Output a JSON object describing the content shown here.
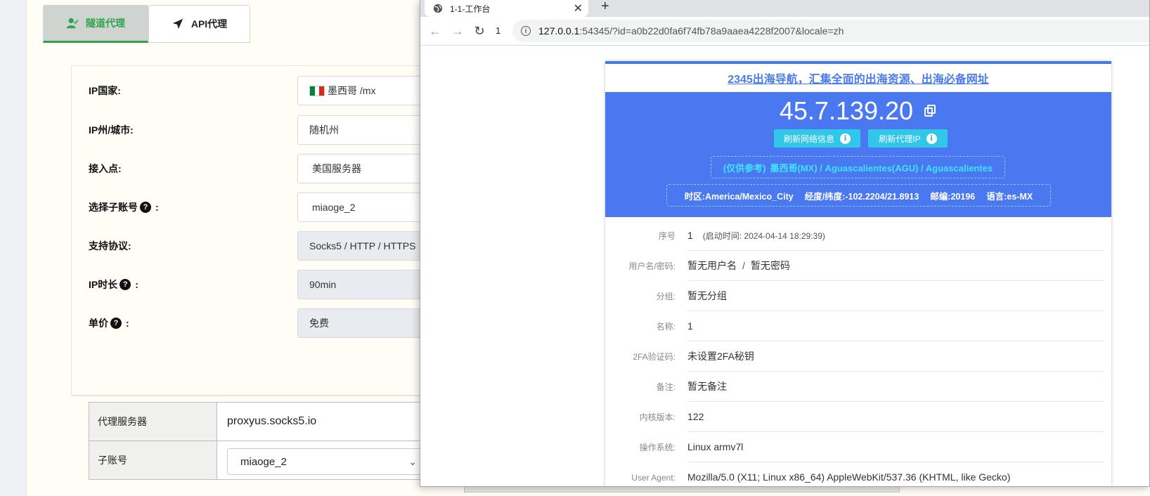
{
  "tabs": {
    "tunnel_label": "隧道代理",
    "api_label": "API代理"
  },
  "form": {
    "rows": [
      {
        "label": "IP国家:",
        "value": "墨西哥 /mx",
        "help": false
      },
      {
        "label": "IP州/城市:",
        "value": "随机州",
        "help": false
      },
      {
        "label": "接入点:",
        "value": "美国服务器",
        "help": false
      },
      {
        "label": "选择子账号",
        "suffix": ":",
        "value": "miaoge_2",
        "help": true
      },
      {
        "label": "支持协议:",
        "value": "Socks5 / HTTP / HTTPS",
        "help": false
      },
      {
        "label": "IP时长",
        "suffix": ":",
        "value": "90min",
        "help": true
      },
      {
        "label": "单价",
        "suffix": ":",
        "value": "免费",
        "help": true
      }
    ]
  },
  "result": {
    "server_label": "代理服务器",
    "server_value": "proxyus.socks5.io",
    "account_label": "子账号",
    "account_value": "miaoge_2"
  },
  "browser": {
    "tab_title": "1-1-工作台",
    "tab_count": "1",
    "url_host": "127.0.0.1",
    "url_rest": ":54345/?id=a0b22d0fa6f74fb78a9aaea4228f2007&locale=zh"
  },
  "card": {
    "nav_link": "2345出海导航，汇集全面的出海资源、出海必备网址",
    "ip": "45.7.139.20",
    "refresh_net_label": "刷新网络信息",
    "refresh_proxy_label": "刷新代理IP",
    "geo_ref": "(仅供参考)",
    "geo_value": "墨西哥(MX) / Aguascalientes(AGU) / Aguascalientes",
    "timezone": "时区:America/Mexico_City",
    "coords": "经度/纬度:-102.2204/21.8913",
    "postal": "邮编:20196",
    "language": "语言:es-MX"
  },
  "info": {
    "seq_label": "序号",
    "seq_value": "1",
    "seq_start": "(启动时间: 2024-04-14 18:29:39)",
    "cred_label": "用户名/密码:",
    "cred_user": "暂无用户名",
    "cred_sep": "/",
    "cred_pass": "暂无密码",
    "group_label": "分组:",
    "group_value": "暂无分组",
    "name_label": "名称:",
    "name_value": "1",
    "twofa_label": "2FA验证码:",
    "twofa_value": "未设置2FA秘钥",
    "note_label": "备注:",
    "note_value": "暂无备注",
    "kernel_label": "内核版本:",
    "kernel_value": "122",
    "os_label": "操作系统:",
    "os_value": "Linux armv7l",
    "ua_label": "User Agent:",
    "ua_value": "Mozilla/5.0 (X11; Linux x86_64) AppleWebKit/537.36 (KHTML, like Gecko)"
  },
  "colors": {
    "accent_green": "#2ea44f",
    "panel_blue": "#4a78f0",
    "button_cyan": "#31c7e8",
    "geo_cyan": "#3fe3ff"
  },
  "icons": {
    "tunnel": "user-check-icon",
    "api": "send-arrow-icon",
    "help": "question-circle-icon",
    "flag": "mexico-flag-icon",
    "copy": "copy-icon",
    "info": "info-icon",
    "globe": "globe-icon"
  }
}
